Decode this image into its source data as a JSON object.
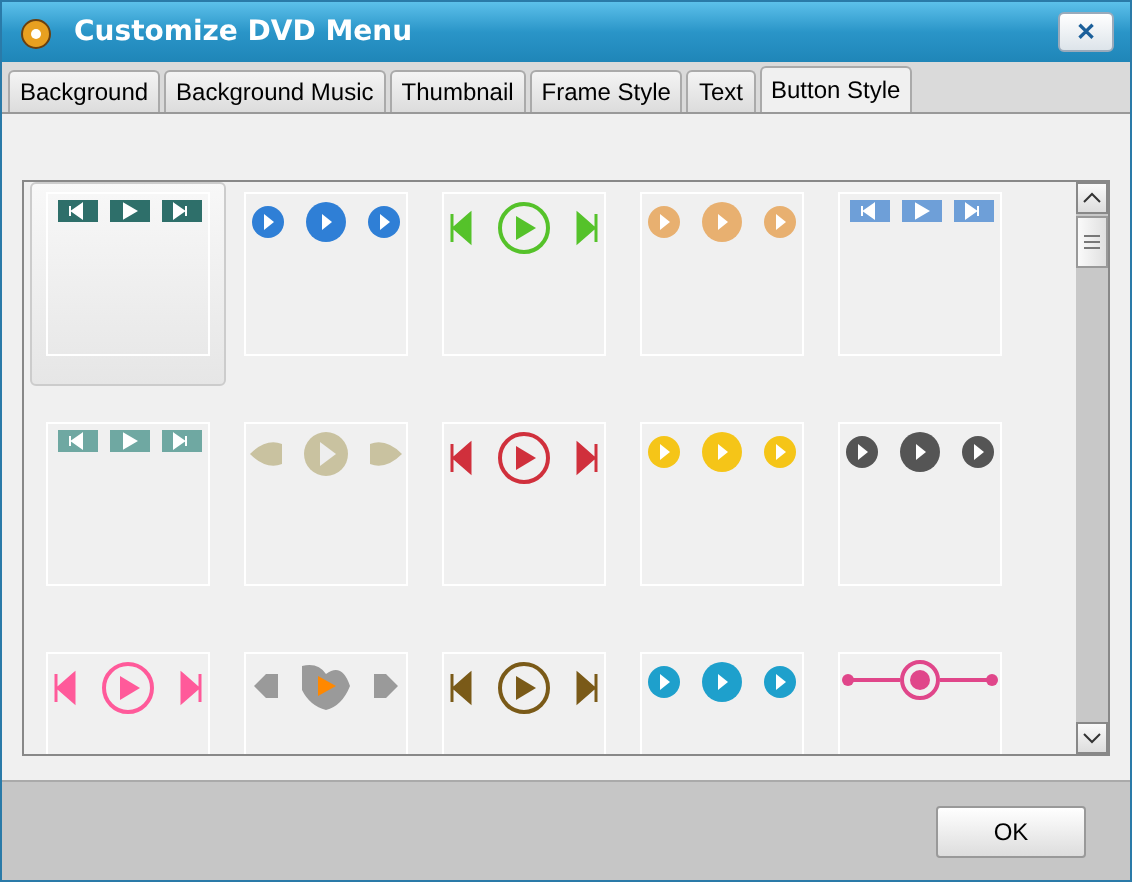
{
  "window": {
    "title": "Customize DVD Menu",
    "close": "✕"
  },
  "tabs": [
    {
      "label": "Background",
      "selected": false
    },
    {
      "label": "Background Music",
      "selected": false
    },
    {
      "label": "Thumbnail",
      "selected": false
    },
    {
      "label": "Frame Style",
      "selected": false
    },
    {
      "label": "Text",
      "selected": false
    },
    {
      "label": "Button Style",
      "selected": true
    }
  ],
  "styles": [
    {
      "kind": "bars",
      "color": "#2e6f6a",
      "selected": true
    },
    {
      "kind": "circles",
      "color": "#2f7fd6",
      "selected": false
    },
    {
      "kind": "triangles",
      "color": "#55c22a",
      "selected": false
    },
    {
      "kind": "circles",
      "color": "#e8b070",
      "selected": false
    },
    {
      "kind": "bars",
      "color": "#6e9fd8",
      "selected": false
    },
    {
      "kind": "bars",
      "color": "#6fa8a2",
      "selected": false
    },
    {
      "kind": "leaves",
      "color": "#c9c2a0",
      "selected": false
    },
    {
      "kind": "triangles",
      "color": "#d0303c",
      "selected": false
    },
    {
      "kind": "circles",
      "color": "#f5c518",
      "selected": false
    },
    {
      "kind": "circles",
      "color": "#555555",
      "selected": false
    },
    {
      "kind": "triangles",
      "color": "#ff5a9a",
      "selected": false
    },
    {
      "kind": "hearts",
      "color": "#9a9a9a",
      "selected": false
    },
    {
      "kind": "triangles",
      "color": "#7a5a18",
      "selected": false
    },
    {
      "kind": "circles",
      "color": "#1ea0cc",
      "selected": false
    },
    {
      "kind": "dart",
      "color": "#e0468a",
      "selected": false
    }
  ],
  "ok_button": "OK"
}
